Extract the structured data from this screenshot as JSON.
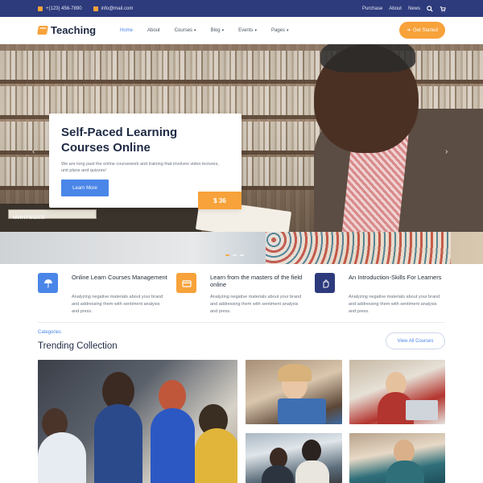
{
  "topbar": {
    "phone": "+(123) 456-7890",
    "email": "info@mail.com",
    "links": [
      "Purchase",
      "About",
      "News"
    ],
    "search_icon": "search-icon",
    "cart_icon": "cart-icon"
  },
  "header": {
    "logo_text": "Teaching",
    "logo_icon": "book-icon",
    "nav": [
      {
        "label": "Home",
        "active": true,
        "dropdown": false
      },
      {
        "label": "About",
        "active": false,
        "dropdown": false
      },
      {
        "label": "Courses",
        "active": false,
        "dropdown": true
      },
      {
        "label": "Blog",
        "active": false,
        "dropdown": true
      },
      {
        "label": "Events",
        "active": false,
        "dropdown": true
      },
      {
        "label": "Pages",
        "active": false,
        "dropdown": true
      }
    ],
    "cta_label": "Get Started",
    "cta_icon": "arrow-icon"
  },
  "hero": {
    "title": "Self-Paced Learning Courses Online",
    "description": "We are long past the online coursework and training that involves video lectures, unit plans and quizzes!",
    "button_label": "Learn More",
    "price": "$ 36",
    "book_title": "МИНУВШЕЕ"
  },
  "features": [
    {
      "title": "Online Learn Courses Management",
      "description": "Analyzing negative materials about your brand and addressing them with sentiment analysis and press.",
      "icon": "umbrella-icon",
      "color": "#4a86e8"
    },
    {
      "title": "Learn from the masters of the field online",
      "description": "Analyzing negative materials about your brand and addressing them with sentiment analysis and press.",
      "icon": "card-icon",
      "color": "#f7a23a"
    },
    {
      "title": "An Introduction-Skills For Learners",
      "description": "Analyzing negative materials about your brand and addressing them with sentiment analysis and press.",
      "icon": "hand-icon",
      "color": "#2d3a7c"
    }
  ],
  "trending": {
    "category_label": "Categories",
    "title": "Trending Collection",
    "view_all_label": "View All Courses"
  },
  "colors": {
    "topbar": "#2d3a7c",
    "accent": "#f7a23a",
    "primary": "#4a86e8"
  }
}
